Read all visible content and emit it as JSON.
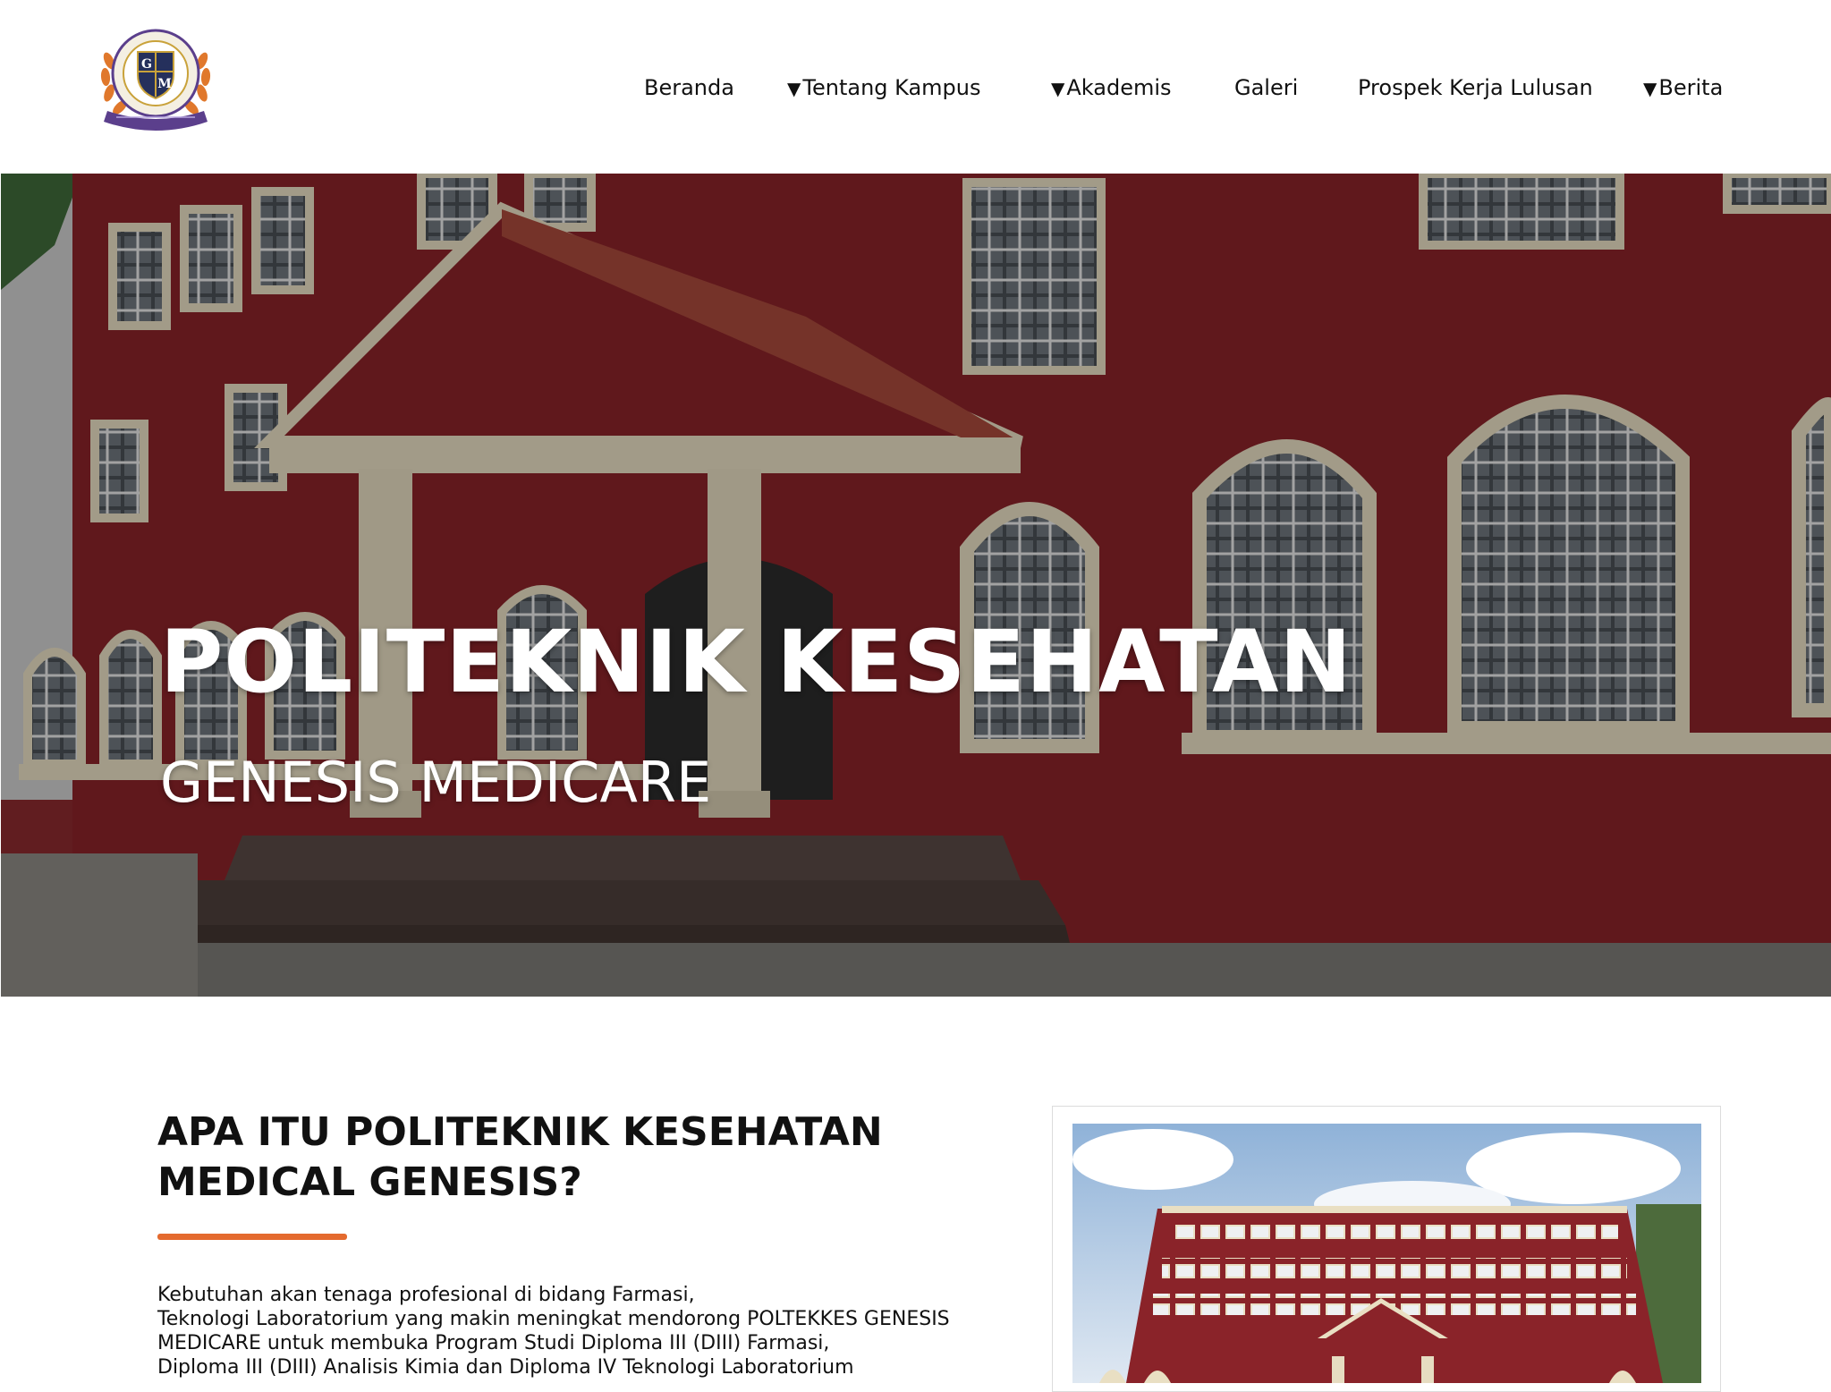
{
  "nav": {
    "items": [
      {
        "label": "Beranda",
        "dropdown": false
      },
      {
        "label": "Tentang Kampus",
        "dropdown": true
      },
      {
        "label": "Akademis",
        "dropdown": true
      },
      {
        "label": "Galeri",
        "dropdown": false
      },
      {
        "label": "Prospek Kerja Lulusan",
        "dropdown": false
      },
      {
        "label": "Berita",
        "dropdown": true
      }
    ],
    "caret": "▼"
  },
  "logo": {
    "monogram_top": "G",
    "monogram_bottom": "M"
  },
  "hero": {
    "title": "POLITEKNIK KESEHATAN",
    "subtitle": "GENESIS MEDICARE"
  },
  "about": {
    "heading": "APA ITU POLITEKNIK KESEHATAN MEDICAL GENESIS?",
    "paragraph_lines": [
      "Kebutuhan akan tenaga profesional di bidang Farmasi,",
      "Teknologi Laboratorium yang makin meningkat mendorong POLTEKKES GENESIS",
      "MEDICARE untuk membuka Program Studi Diploma III (DIII) Farmasi,",
      "Diploma III (DIII) Analisis Kimia dan Diploma IV Teknologi Laboratorium"
    ]
  },
  "colors": {
    "accent": "#e46a2e",
    "building_red": "#7a1f25",
    "trim_cream": "#e9dfc3",
    "logo_purple": "#5b3f8c",
    "logo_orange": "#e0782c",
    "logo_navy": "#25305c"
  }
}
